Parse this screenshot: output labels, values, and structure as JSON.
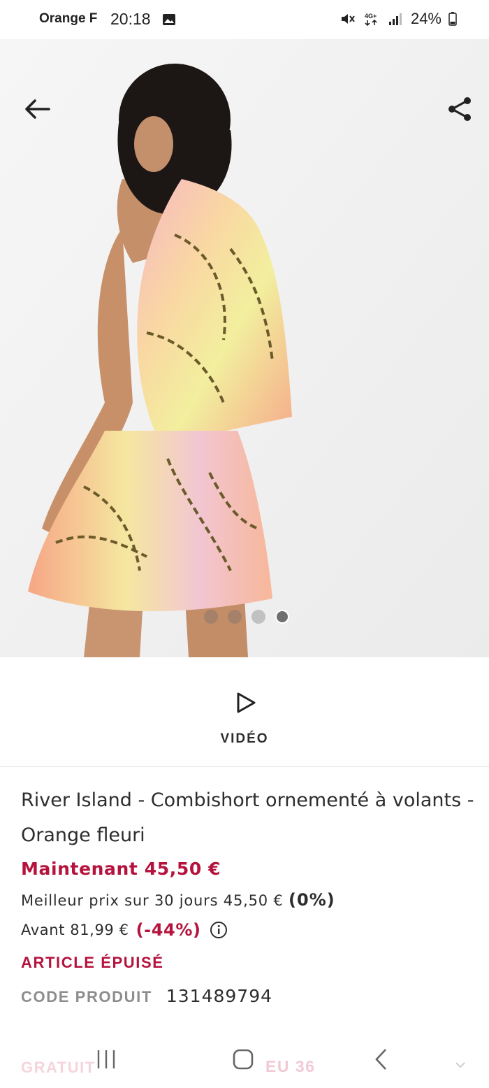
{
  "status_bar": {
    "carrier": "Orange F",
    "time": "20:18",
    "network": "4G+",
    "battery": "24%"
  },
  "gallery": {
    "image_count": 4,
    "active_index": 3
  },
  "video": {
    "label": "VIDÉO"
  },
  "product": {
    "title": "River Island - Combishort ornementé à volants - Orange fleuri",
    "price_now": "Maintenant 45,50 €",
    "best_price_text": "Meilleur prix sur 30 jours 45,50 €",
    "best_price_pct": "(0%)",
    "before_text": "Avant 81,99 €",
    "before_discount": "(-44%)",
    "stock_status": "ARTICLE ÉPUISÉ",
    "code_label": "CODE PRODUIT",
    "code_value": "131489794"
  },
  "sticky_bar": {
    "left_label": "GRATUIT",
    "size": "EU 36"
  },
  "colors": {
    "accent": "#b5133d",
    "text": "#2d2d2d",
    "muted": "#8d8d8d"
  },
  "icons": [
    "back-arrow-icon",
    "share-icon",
    "play-icon",
    "info-icon",
    "recents-icon",
    "home-icon",
    "nav-back-icon"
  ]
}
